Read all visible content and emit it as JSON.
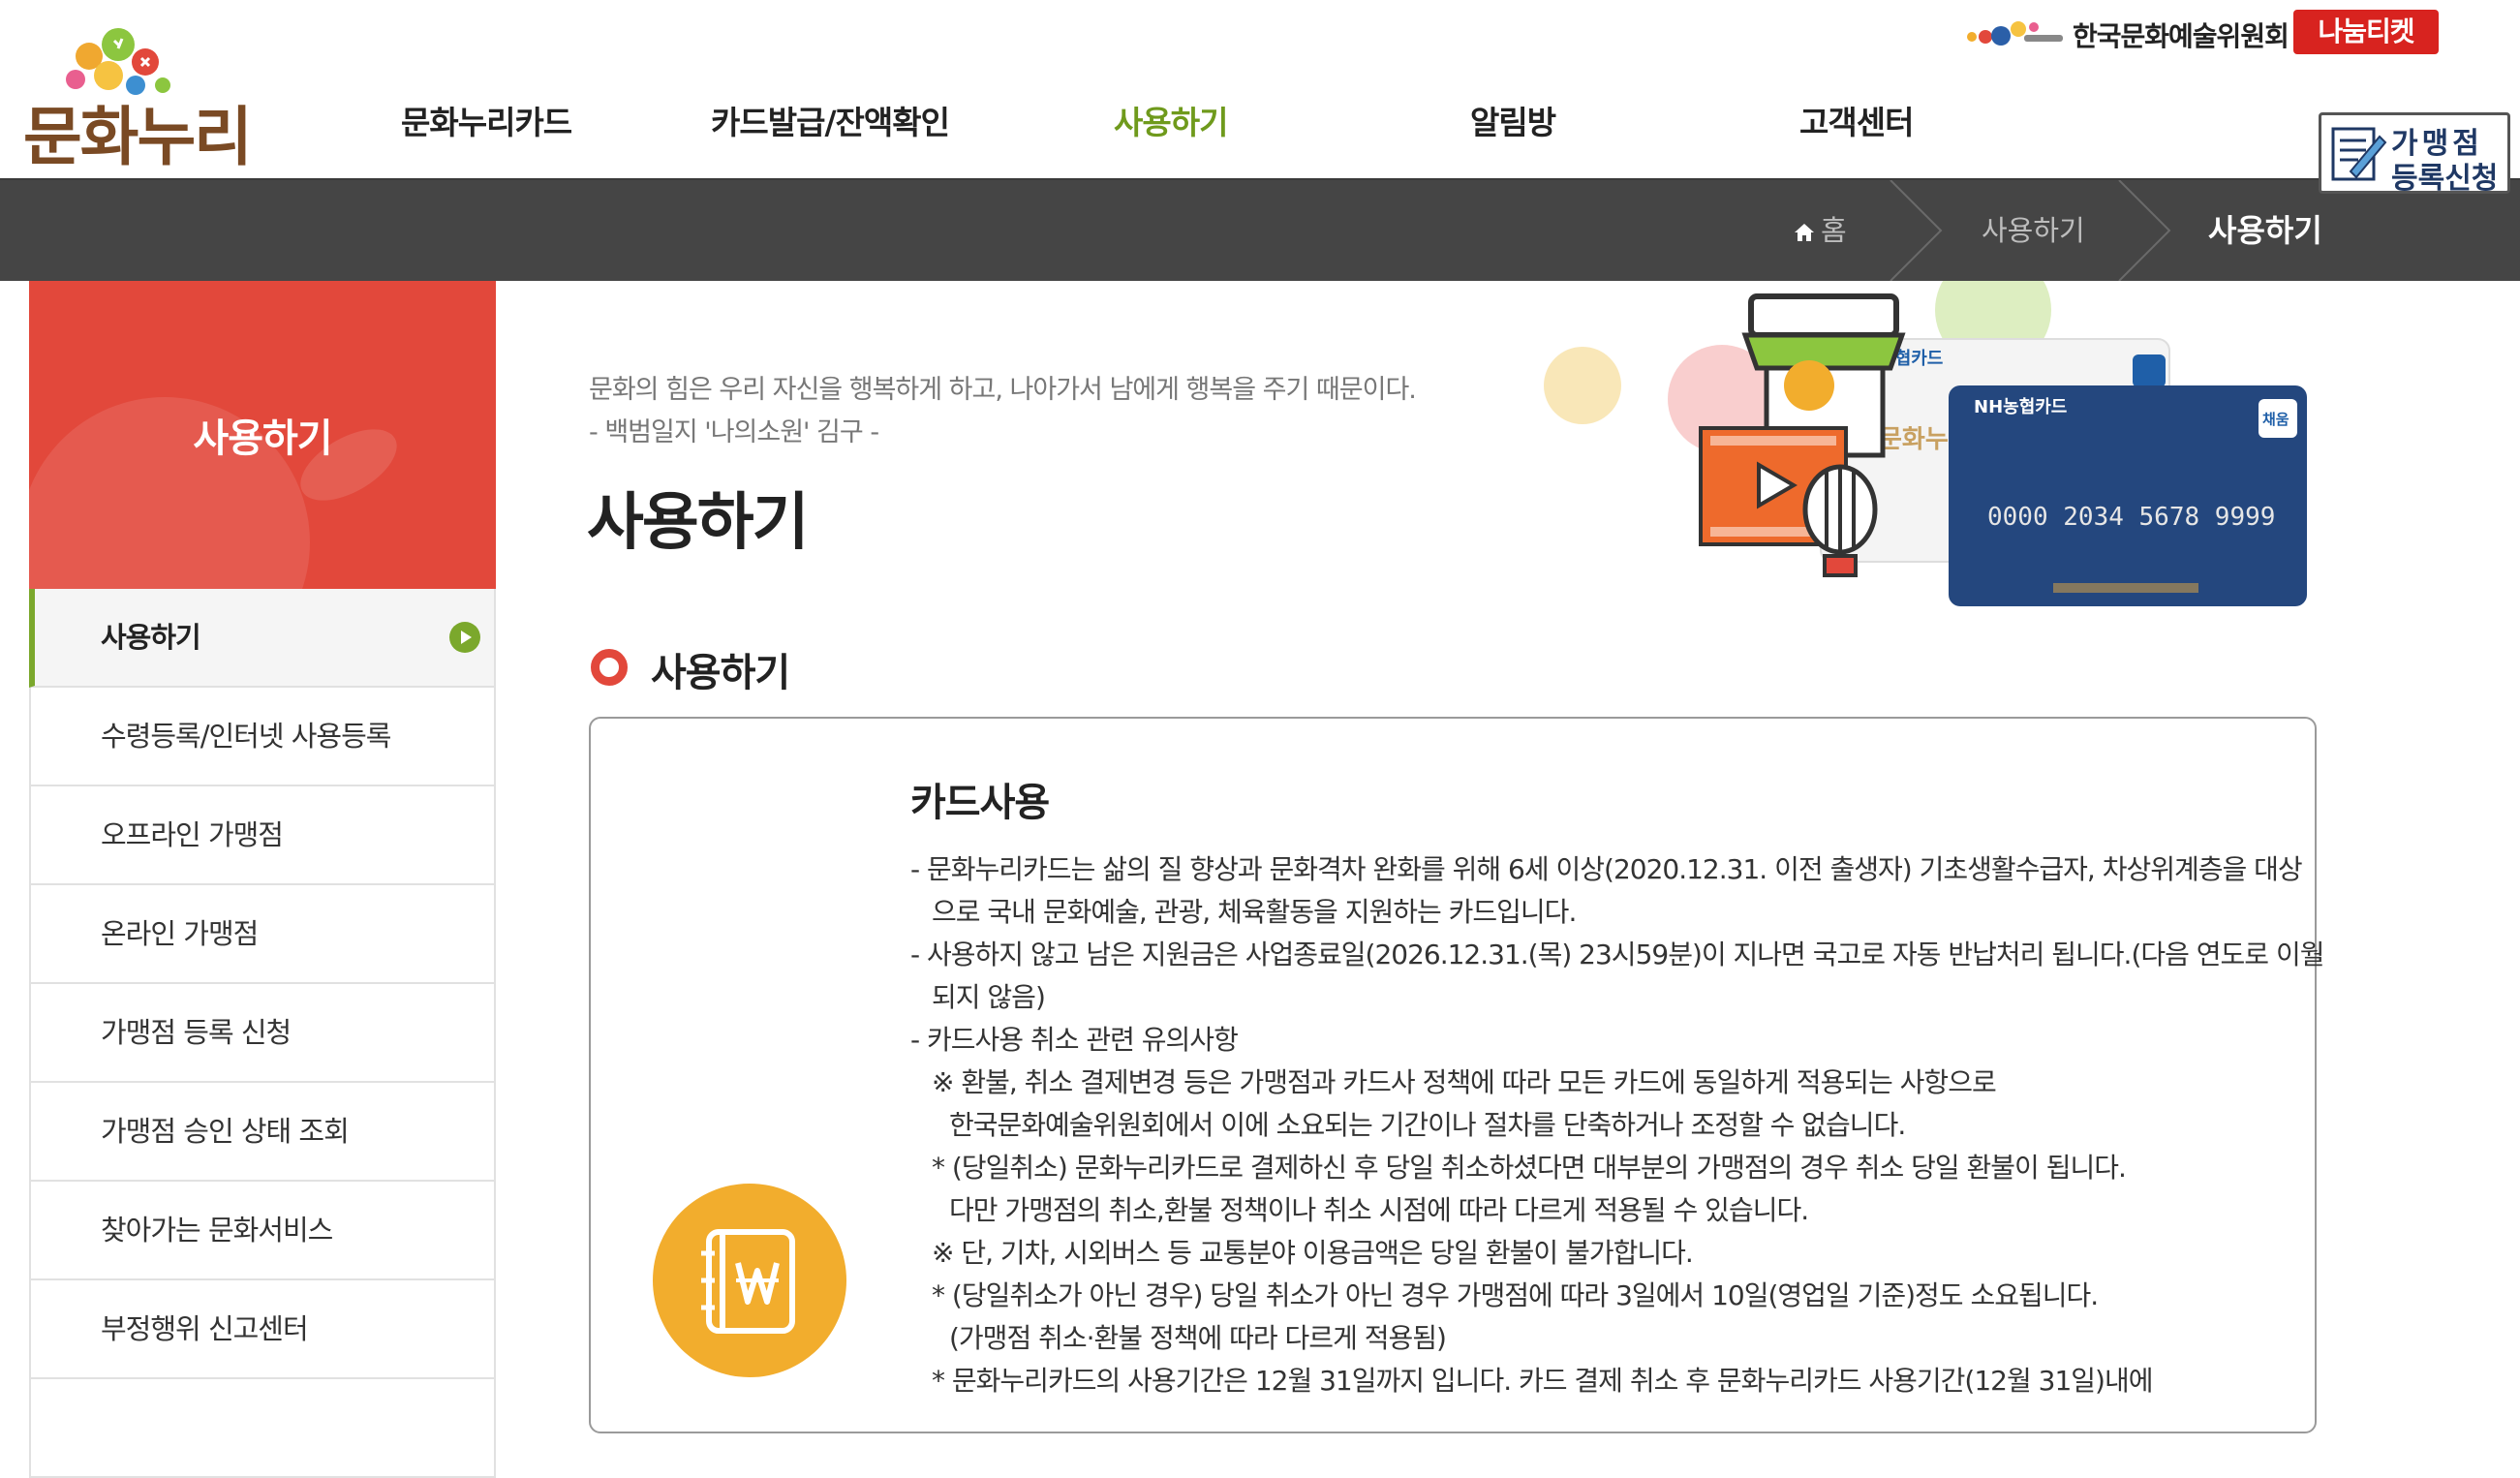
{
  "header": {
    "logo_text": "문화누리",
    "nav": [
      {
        "label": "문화누리카드"
      },
      {
        "label": "카드발급/잔액확인"
      },
      {
        "label": "사용하기"
      },
      {
        "label": "알림방"
      },
      {
        "label": "고객센터"
      }
    ],
    "arts_council": "한국문화예술위원회",
    "nanum_ticket": "나눔티켓",
    "register_line1": "가맹점",
    "register_line2": "등록신청"
  },
  "breadcrumb": {
    "home": "홈",
    "level1": "사용하기",
    "current": "사용하기"
  },
  "sidebar": {
    "title": "사용하기",
    "items": [
      {
        "label": "사용하기"
      },
      {
        "label": "수령등록/인터넷 사용등록"
      },
      {
        "label": "오프라인 가맹점"
      },
      {
        "label": "온라인 가맹점"
      },
      {
        "label": "가맹점 등록 신청"
      },
      {
        "label": "가맹점 승인 상태 조회"
      },
      {
        "label": "찾아가는 문화서비스"
      },
      {
        "label": "부정행위 신고센터"
      }
    ]
  },
  "intro": {
    "quote": "문화의 힘은 우리 자신을 행복하게 하고, 나아가서 남에게 행복을 주기 때문이다.",
    "quote_source": "- 백범일지 '나의소원' 김구 -",
    "page_title": "사용하기"
  },
  "visual": {
    "card_brand": "NH농협카드",
    "card_number": "0000 2034 5678 9999",
    "card_badge": "채움",
    "card_back_text": "문화누리"
  },
  "section": {
    "title": "사용하기",
    "box_title": "카드사용",
    "lines": [
      "- 문화누리카드는 삶의 질 향상과 문화격차 완화를 위해 6세 이상(2020.12.31. 이전 출생자) 기초생활수급자, 차상위계층을 대상",
      "으로 국내 문화예술, 관광, 체육활동을 지원하는 카드입니다.",
      "- 사용하지 않고 남은 지원금은 사업종료일(2026.12.31.(목) 23시59분)이 지나면 국고로 자동 반납처리 됩니다.(다음 연도로 이월",
      "되지 않음)",
      "- 카드사용 취소 관련 유의사항",
      "※ 환불, 취소 결제변경 등은 가맹점과 카드사 정책에 따라 모든 카드에 동일하게 적용되는 사항으로",
      "한국문화예술위원회에서 이에 소요되는 기간이나 절차를 단축하거나 조정할 수 없습니다.",
      "* (당일취소) 문화누리카드로 결제하신 후 당일 취소하셨다면 대부분의 가맹점의 경우 취소 당일 환불이 됩니다.",
      "다만 가맹점의 취소,환불 정책이나 취소 시점에 따라 다르게 적용될 수 있습니다.",
      "※ 단, 기차, 시외버스 등 교통분야 이용금액은 당일 환불이 불가합니다.",
      "* (당일취소가 아닌 경우) 당일 취소가 아닌 경우 가맹점에 따라 3일에서 10일(영업일 기준)정도 소요됩니다.",
      "(가맹점 취소·환불 정책에 따라 다르게 적용됨)",
      "* 문화누리카드의 사용기간은 12월 31일까지 입니다. 카드 결제 취소 후 문화누리카드 사용기간(12월 31일)내에"
    ]
  },
  "colors": {
    "accent_green": "#6f9a1c",
    "accent_red": "#e2483b",
    "location_bar": "#454545",
    "icon_yellow": "#f2ad2d"
  }
}
